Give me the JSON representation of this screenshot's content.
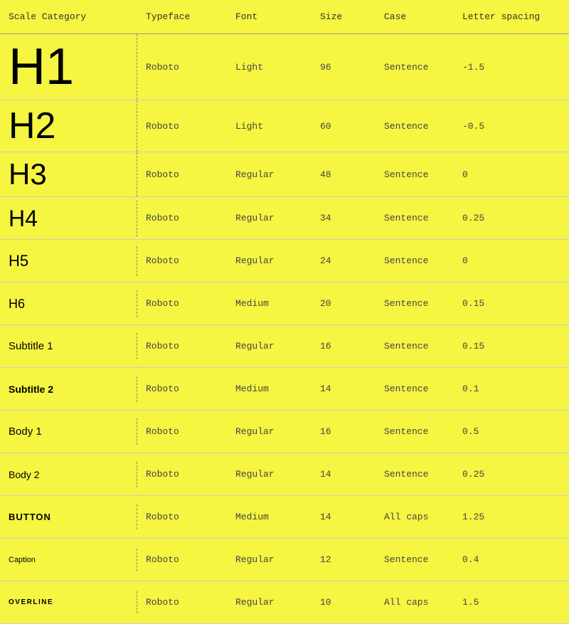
{
  "header": {
    "col1": "Scale Category",
    "col2": "Typeface",
    "col3": "Font",
    "col4": "Size",
    "col5": "Case",
    "col6": "Letter spacing"
  },
  "rows": [
    {
      "label": "H1",
      "style": "h1-label",
      "typeface": "Roboto",
      "font": "Light",
      "size": "96",
      "case": "Sentence",
      "spacing": "-1.5"
    },
    {
      "label": "H2",
      "style": "h2-label",
      "typeface": "Roboto",
      "font": "Light",
      "size": "60",
      "case": "Sentence",
      "spacing": "-0.5"
    },
    {
      "label": "H3",
      "style": "h3-label",
      "typeface": "Roboto",
      "font": "Regular",
      "size": "48",
      "case": "Sentence",
      "spacing": "0"
    },
    {
      "label": "H4",
      "style": "h4-label",
      "typeface": "Roboto",
      "font": "Regular",
      "size": "34",
      "case": "Sentence",
      "spacing": "0.25"
    },
    {
      "label": "H5",
      "style": "h5-label",
      "typeface": "Roboto",
      "font": "Regular",
      "size": "24",
      "case": "Sentence",
      "spacing": "0"
    },
    {
      "label": "H6",
      "style": "h6-label",
      "typeface": "Roboto",
      "font": "Medium",
      "size": "20",
      "case": "Sentence",
      "spacing": "0.15"
    },
    {
      "label": "Subtitle 1",
      "style": "subtitle1-label",
      "typeface": "Roboto",
      "font": "Regular",
      "size": "16",
      "case": "Sentence",
      "spacing": "0.15"
    },
    {
      "label": "Subtitle 2",
      "style": "subtitle2-label",
      "typeface": "Roboto",
      "font": "Medium",
      "size": "14",
      "case": "Sentence",
      "spacing": "0.1"
    },
    {
      "label": "Body 1",
      "style": "body1-label",
      "typeface": "Roboto",
      "font": "Regular",
      "size": "16",
      "case": "Sentence",
      "spacing": "0.5"
    },
    {
      "label": "Body 2",
      "style": "body2-label",
      "typeface": "Roboto",
      "font": "Regular",
      "size": "14",
      "case": "Sentence",
      "spacing": "0.25"
    },
    {
      "label": "BUTTON",
      "style": "button-label",
      "typeface": "Roboto",
      "font": "Medium",
      "size": "14",
      "case": "All caps",
      "spacing": "1.25"
    },
    {
      "label": "Caption",
      "style": "caption-label",
      "typeface": "Roboto",
      "font": "Regular",
      "size": "12",
      "case": "Sentence",
      "spacing": "0.4"
    },
    {
      "label": "OVERLINE",
      "style": "overline-label",
      "typeface": "Roboto",
      "font": "Regular",
      "size": "10",
      "case": "All caps",
      "spacing": "1.5"
    }
  ]
}
